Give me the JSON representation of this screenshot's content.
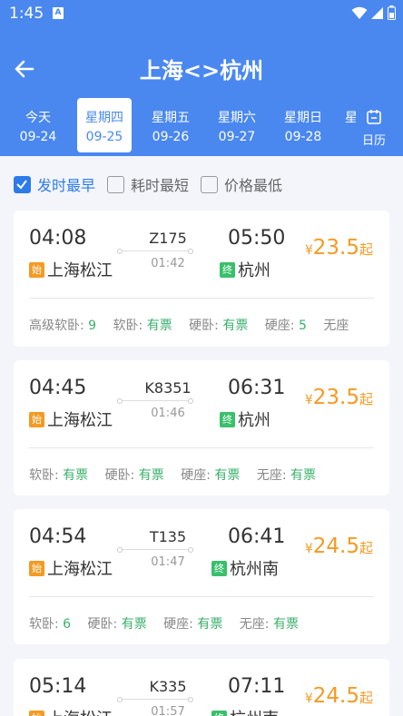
{
  "status_bar": {
    "time": "1:45",
    "notif_icon": "A"
  },
  "header": {
    "title": "上海<>杭州",
    "calendar_label": "日历"
  },
  "date_tabs": [
    {
      "weekday": "今天",
      "date": "09-24"
    },
    {
      "weekday": "星期四",
      "date": "09-25",
      "active": true
    },
    {
      "weekday": "星期五",
      "date": "09-26"
    },
    {
      "weekday": "星期六",
      "date": "09-27"
    },
    {
      "weekday": "星期日",
      "date": "09-28"
    },
    {
      "weekday": "星",
      "date": ""
    }
  ],
  "sort_options": [
    {
      "label": "发时最早",
      "checked": true
    },
    {
      "label": "耗时最短",
      "checked": false
    },
    {
      "label": "价格最低",
      "checked": false
    }
  ],
  "badges": {
    "start": "始",
    "end": "终"
  },
  "currency": "¥",
  "price_suffix": "起",
  "trains": [
    {
      "dep_time": "04:08",
      "dep_station": "上海松江",
      "train_no": "Z175",
      "duration": "01:42",
      "arr_time": "05:50",
      "arr_station": "杭州",
      "price": "23.5",
      "seats": [
        {
          "name": "高级软卧: ",
          "avail": "9"
        },
        {
          "name": "软卧: ",
          "avail": "有票"
        },
        {
          "name": "硬卧: ",
          "avail": "有票"
        },
        {
          "name": "硬座: ",
          "avail": "5"
        },
        {
          "name": "无座",
          "avail": ""
        }
      ]
    },
    {
      "dep_time": "04:45",
      "dep_station": "上海松江",
      "train_no": "K8351",
      "duration": "01:46",
      "arr_time": "06:31",
      "arr_station": "杭州",
      "price": "23.5",
      "seats": [
        {
          "name": "软卧: ",
          "avail": "有票"
        },
        {
          "name": "硬卧: ",
          "avail": "有票"
        },
        {
          "name": "硬座: ",
          "avail": "有票"
        },
        {
          "name": "无座: ",
          "avail": "有票"
        }
      ]
    },
    {
      "dep_time": "04:54",
      "dep_station": "上海松江",
      "train_no": "T135",
      "duration": "01:47",
      "arr_time": "06:41",
      "arr_station": "杭州南",
      "price": "24.5",
      "seats": [
        {
          "name": "软卧: ",
          "avail": "6"
        },
        {
          "name": "硬卧: ",
          "avail": "有票"
        },
        {
          "name": "硬座: ",
          "avail": "有票"
        },
        {
          "name": "无座: ",
          "avail": "有票"
        }
      ]
    },
    {
      "dep_time": "05:14",
      "dep_station": "上海松江",
      "train_no": "K335",
      "duration": "01:57",
      "arr_time": "07:11",
      "arr_station": "杭州南",
      "price": "24.5",
      "seats": []
    }
  ],
  "colors": {
    "primary": "#4a88f0",
    "accent_blue": "#2d7be8",
    "price": "#f59a23",
    "available": "#39b06b"
  }
}
